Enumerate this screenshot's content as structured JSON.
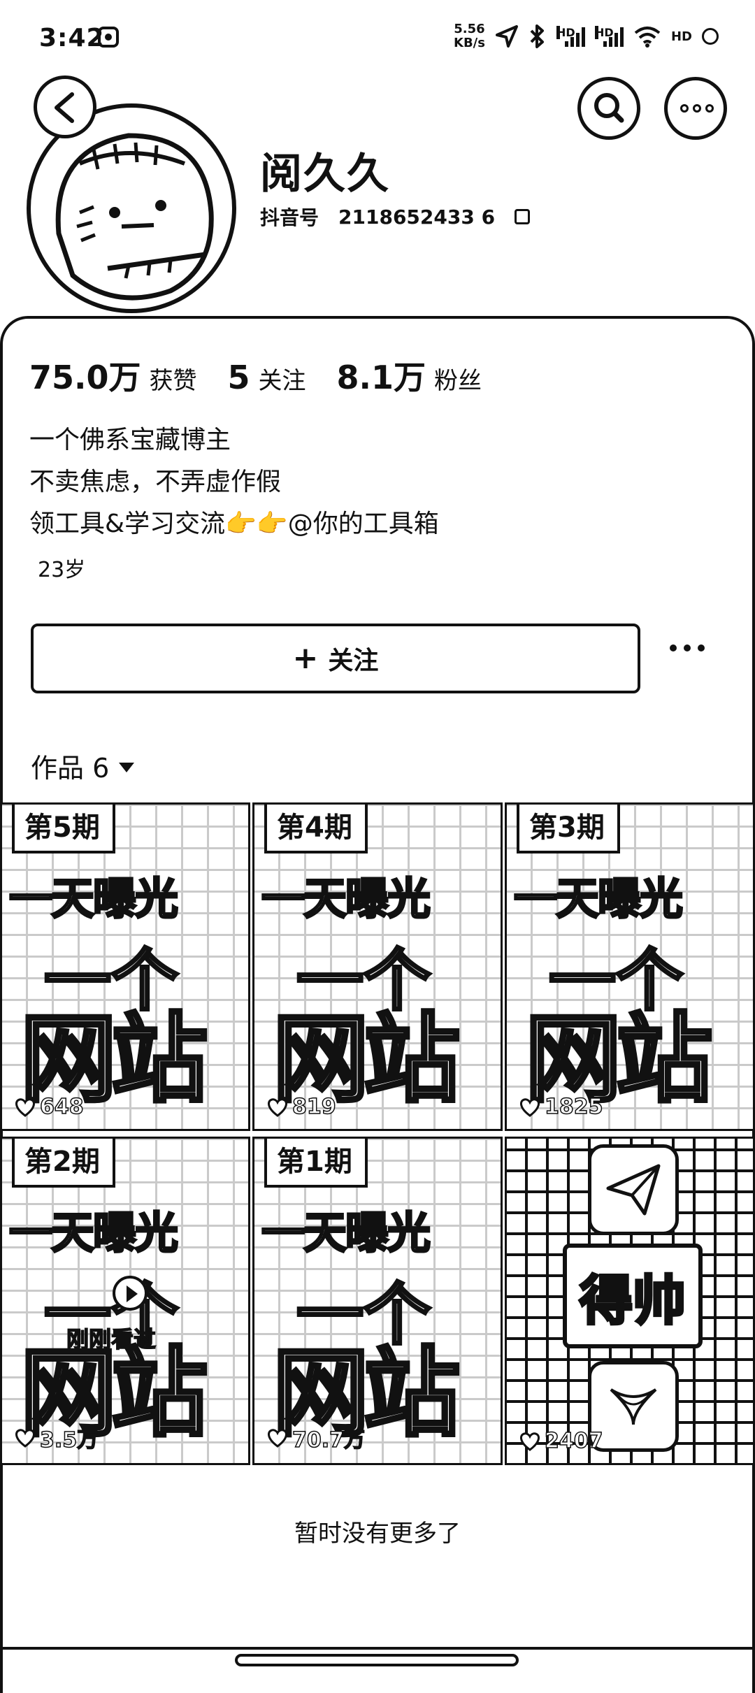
{
  "status_bar": {
    "time": "3:42",
    "net_speed_top": "5.56",
    "net_speed_bottom": "KB/s",
    "hd_a": "HD",
    "hd_b": "HD",
    "extra": "HD"
  },
  "profile": {
    "name": "阅久久",
    "id_label": "抖音号",
    "id_value": "2118652433 6"
  },
  "stats": [
    {
      "num": "75.0万",
      "label": "获赞"
    },
    {
      "num": "5",
      "label": "关注"
    },
    {
      "num": "8.1万",
      "label": "粉丝"
    }
  ],
  "bio": {
    "line1": "一个佛系宝藏博主",
    "line2": "不卖焦虑，不弄虚作假",
    "line3": "领工具&学习交流👉👉@你的工具箱"
  },
  "age": "23岁",
  "follow_button": {
    "label": "关注"
  },
  "works_tab": {
    "label": "作品 6"
  },
  "tiles": [
    {
      "episode": "第5期",
      "line1": "一天曝光",
      "line2": "一个",
      "line3": "网站",
      "likes": "648"
    },
    {
      "episode": "第4期",
      "line1": "一天曝光",
      "line2": "一个",
      "line3": "网站",
      "likes": "819"
    },
    {
      "episode": "第3期",
      "line1": "一天曝光",
      "line2": "一个",
      "line3": "网站",
      "likes": "1825"
    },
    {
      "episode": "第2期",
      "line1": "一天曝光",
      "line2": "一个",
      "line3": "网站",
      "likes": "3.5万",
      "seen": "刚刚看过"
    },
    {
      "episode": "第1期",
      "line1": "一天曝光",
      "line2": "一个",
      "line3": "网站",
      "likes": "70.7万"
    },
    {
      "sign": "得帅",
      "likes": "2407"
    }
  ],
  "footer": {
    "no_more": "暂时没有更多了"
  }
}
